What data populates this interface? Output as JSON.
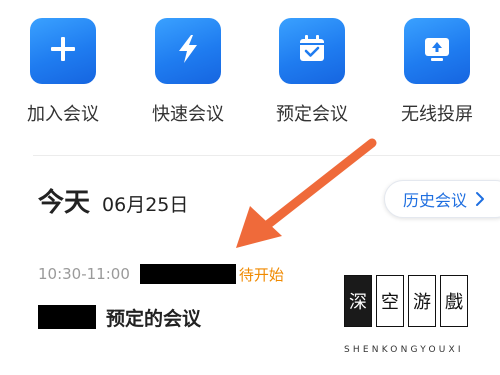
{
  "actions": [
    {
      "label": "加入会议",
      "icon": "plus-icon"
    },
    {
      "label": "快速会议",
      "icon": "lightning-icon"
    },
    {
      "label": "预定会议",
      "icon": "calendar-check-icon"
    },
    {
      "label": "无线投屏",
      "icon": "screen-cast-icon"
    }
  ],
  "date_header": {
    "today": "今天",
    "date": "06月25日"
  },
  "history_button": {
    "label": "历史会议"
  },
  "meeting": {
    "time": "10:30-11:00",
    "status": "待开始",
    "title": "预定的会议"
  },
  "watermark": {
    "chars": [
      "深",
      "空",
      "游",
      "戲"
    ],
    "subtitle": "SHENKONGYOUXI"
  },
  "colors": {
    "tile_blue": "#1f7cf0",
    "link_blue": "#1f6fe0",
    "status_orange": "#f08a00",
    "arrow_orange": "#ef6a3a"
  }
}
